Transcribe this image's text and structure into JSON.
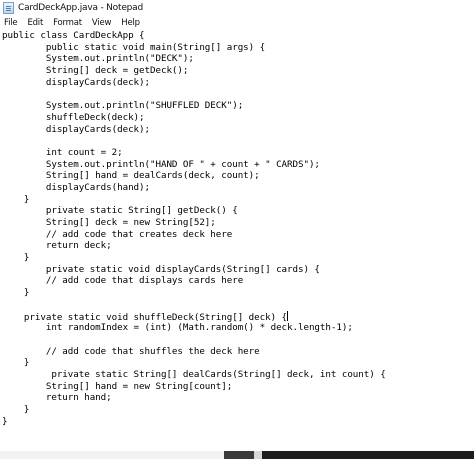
{
  "window": {
    "title": "CardDeckApp.java - Notepad",
    "icon": "notepad-icon"
  },
  "menu": [
    "File",
    "Edit",
    "Format",
    "View",
    "Help"
  ],
  "code_lines": [
    "public class CardDeckApp {",
    "        public static void main(String[] args) {",
    "        System.out.println(\"DECK\");",
    "        String[] deck = getDeck();",
    "        displayCards(deck);",
    "",
    "        System.out.println(\"SHUFFLED DECK\");",
    "        shuffleDeck(deck);",
    "        displayCards(deck);",
    "",
    "        int count = 2;",
    "        System.out.println(\"HAND OF \" + count + \" CARDS\");",
    "        String[] hand = dealCards(deck, count);",
    "        displayCards(hand);",
    "    }",
    "        private static String[] getDeck() {",
    "        String[] deck = new String[52];",
    "        // add code that creates deck here",
    "        return deck;",
    "    }",
    "        private static void displayCards(String[] cards) {",
    "        // add code that displays cards here",
    "    }",
    "",
    "    private static void shuffleDeck(String[] deck) {",
    "        int randomIndex = (int) (Math.random() * deck.length-1);",
    "",
    "        // add code that shuffles the deck here",
    "    }",
    "         private static String[] dealCards(String[] deck, int count) {",
    "        String[] hand = new String[count];",
    "        return hand;",
    "    }",
    "}"
  ],
  "caret_line_index": 24
}
